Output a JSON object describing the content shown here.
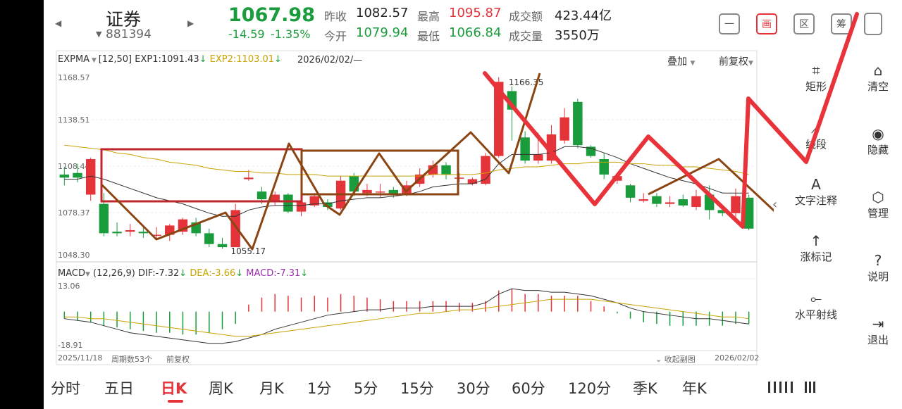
{
  "header": {
    "prev_arrow": "◀",
    "next_arrow": "▶",
    "name": "证券",
    "code": "881394",
    "price": "1067.98",
    "change": "-14.59",
    "change_pct": "-1.35%",
    "stats": [
      {
        "label": "昨收",
        "value": "1082.57",
        "color": "dark"
      },
      {
        "label": "最高",
        "value": "1095.87",
        "color": "red"
      },
      {
        "label": "成交额",
        "value": "423.44亿",
        "color": "dark"
      },
      {
        "label": "今开",
        "value": "1079.94",
        "color": "green"
      },
      {
        "label": "最低",
        "value": "1066.84",
        "color": "green"
      },
      {
        "label": "成交量",
        "value": "3550万",
        "color": "dark"
      }
    ],
    "tool_buttons": [
      {
        "name": "minimize-icon",
        "glyph": "一"
      },
      {
        "name": "draw-icon",
        "glyph": "画"
      },
      {
        "name": "range-icon",
        "glyph": "区"
      },
      {
        "name": "chip-icon",
        "glyph": "筹"
      }
    ]
  },
  "indicator_bar": {
    "name": "EXPMA",
    "params": "[12,50]",
    "exp1_label": "EXP1:1091.43",
    "exp2_label": "EXP2:1103.01",
    "date": "2026/02/02/—",
    "overlay": "叠加",
    "adjust": "前复权"
  },
  "macd_bar": {
    "name": "MACD",
    "params": "(12,26,9)",
    "dif": "DIF:-7.32",
    "dea": "DEA:-3.66",
    "macd": "MACD:-7.31"
  },
  "footer": {
    "start_date": "2025/11/18",
    "period_count": "周期数53个",
    "adjust": "前复权",
    "collapse": "收起副图",
    "end_date": "2026/02/02"
  },
  "draw_tools": [
    {
      "name": "rect-tool",
      "icon": "⌗",
      "label": "矩形"
    },
    {
      "name": "segment-tool",
      "icon": "⟋",
      "label": "线段"
    },
    {
      "name": "text-tool",
      "icon": "A",
      "label": "文字注释"
    },
    {
      "name": "rise-mark-tool",
      "icon": "↑",
      "label": "涨标记"
    },
    {
      "name": "ray-tool",
      "icon": "⟜",
      "label": "水平射线"
    }
  ],
  "side_tools": [
    {
      "name": "clear",
      "icon": "⌂",
      "label": "清空"
    },
    {
      "name": "hide",
      "icon": "◉",
      "label": "隐藏"
    },
    {
      "name": "manage",
      "icon": "⬡",
      "label": "管理"
    },
    {
      "name": "help",
      "icon": "?",
      "label": "说明"
    },
    {
      "name": "exit",
      "icon": "⇥",
      "label": "退出"
    }
  ],
  "tabs": [
    "分时",
    "五日",
    "日K",
    "周K",
    "月K",
    "1分",
    "5分",
    "15分",
    "30分",
    "60分",
    "120分",
    "季K",
    "年K"
  ],
  "active_tab": "日K",
  "chart_data": {
    "type": "candlestick",
    "ylim": [
      1048.3,
      1168.57
    ],
    "y_tick_labels": [
      "1168.57",
      "1138.51",
      "1108.44",
      "1078.37",
      "1048.30"
    ],
    "high_label": "1166.35",
    "low_label": "1055.17",
    "candles": [
      {
        "o": 1103,
        "c": 1101,
        "h": 1108,
        "l": 1096
      },
      {
        "o": 1104,
        "c": 1101,
        "h": 1110,
        "l": 1098
      },
      {
        "o": 1090,
        "c": 1113,
        "h": 1114,
        "l": 1086
      },
      {
        "o": 1084,
        "c": 1065,
        "h": 1091,
        "l": 1063
      },
      {
        "o": 1066,
        "c": 1065,
        "h": 1072,
        "l": 1063
      },
      {
        "o": 1066,
        "c": 1067,
        "h": 1071,
        "l": 1063
      },
      {
        "o": 1066,
        "c": 1065,
        "h": 1069,
        "l": 1062
      },
      {
        "o": 1064,
        "c": 1064,
        "h": 1069,
        "l": 1061
      },
      {
        "o": 1064,
        "c": 1070,
        "h": 1071,
        "l": 1060
      },
      {
        "o": 1066,
        "c": 1074,
        "h": 1075,
        "l": 1064
      },
      {
        "o": 1072,
        "c": 1065,
        "h": 1075,
        "l": 1063
      },
      {
        "o": 1065,
        "c": 1058,
        "h": 1068,
        "l": 1056
      },
      {
        "o": 1058,
        "c": 1056,
        "h": 1062,
        "l": 1055
      },
      {
        "o": 1056,
        "c": 1080,
        "h": 1084,
        "l": 1056
      },
      {
        "o": 1100,
        "c": 1101,
        "h": 1106,
        "l": 1099
      },
      {
        "o": 1092,
        "c": 1087,
        "h": 1095,
        "l": 1084
      },
      {
        "o": 1085,
        "c": 1090,
        "h": 1092,
        "l": 1083
      },
      {
        "o": 1090,
        "c": 1079,
        "h": 1091,
        "l": 1078
      },
      {
        "o": 1079,
        "c": 1085,
        "h": 1090,
        "l": 1076
      },
      {
        "o": 1083,
        "c": 1089,
        "h": 1091,
        "l": 1082
      },
      {
        "o": 1085,
        "c": 1082,
        "h": 1087,
        "l": 1080
      },
      {
        "o": 1081,
        "c": 1099,
        "h": 1102,
        "l": 1080
      },
      {
        "o": 1102,
        "c": 1092,
        "h": 1104,
        "l": 1089
      },
      {
        "o": 1091,
        "c": 1093,
        "h": 1097,
        "l": 1089
      },
      {
        "o": 1092,
        "c": 1092,
        "h": 1097,
        "l": 1088
      },
      {
        "o": 1093,
        "c": 1090,
        "h": 1095,
        "l": 1088
      },
      {
        "o": 1090,
        "c": 1096,
        "h": 1099,
        "l": 1089
      },
      {
        "o": 1097,
        "c": 1103,
        "h": 1107,
        "l": 1095
      },
      {
        "o": 1103,
        "c": 1109,
        "h": 1112,
        "l": 1101
      },
      {
        "o": 1109,
        "c": 1103,
        "h": 1111,
        "l": 1100
      },
      {
        "o": 1101,
        "c": 1101,
        "h": 1104,
        "l": 1098
      },
      {
        "o": 1097,
        "c": 1100,
        "h": 1101,
        "l": 1096
      },
      {
        "o": 1097,
        "c": 1115,
        "h": 1117,
        "l": 1096
      },
      {
        "o": 1115,
        "c": 1163,
        "h": 1166,
        "l": 1114
      },
      {
        "o": 1157,
        "c": 1145,
        "h": 1160,
        "l": 1125
      },
      {
        "o": 1127,
        "c": 1112,
        "h": 1131,
        "l": 1110
      },
      {
        "o": 1112,
        "c": 1116,
        "h": 1130,
        "l": 1110
      },
      {
        "o": 1112,
        "c": 1129,
        "h": 1135,
        "l": 1110
      },
      {
        "o": 1125,
        "c": 1140,
        "h": 1146,
        "l": 1123
      },
      {
        "o": 1150,
        "c": 1122,
        "h": 1152,
        "l": 1120
      },
      {
        "o": 1121,
        "c": 1115,
        "h": 1122,
        "l": 1114
      },
      {
        "o": 1113,
        "c": 1103,
        "h": 1117,
        "l": 1100
      },
      {
        "o": 1099,
        "c": 1102,
        "h": 1103,
        "l": 1097
      },
      {
        "o": 1096,
        "c": 1088,
        "h": 1097,
        "l": 1085
      },
      {
        "o": 1086,
        "c": 1087,
        "h": 1091,
        "l": 1085
      },
      {
        "o": 1089,
        "c": 1084,
        "h": 1091,
        "l": 1082
      },
      {
        "o": 1084,
        "c": 1085,
        "h": 1089,
        "l": 1082
      },
      {
        "o": 1087,
        "c": 1083,
        "h": 1090,
        "l": 1082
      },
      {
        "o": 1082,
        "c": 1089,
        "h": 1093,
        "l": 1080
      },
      {
        "o": 1090,
        "c": 1080,
        "h": 1096,
        "l": 1074
      },
      {
        "o": 1080,
        "c": 1078,
        "h": 1083,
        "l": 1076
      },
      {
        "o": 1078,
        "c": 1089,
        "h": 1094,
        "l": 1073
      },
      {
        "o": 1088,
        "c": 1068,
        "h": 1090,
        "l": 1067
      }
    ],
    "exp1": [
      1100,
      1100,
      1102,
      1100,
      1097,
      1094,
      1091,
      1088,
      1086,
      1084,
      1081,
      1078,
      1076,
      1076,
      1080,
      1082,
      1083,
      1083,
      1083,
      1084,
      1084,
      1086,
      1087,
      1088,
      1088,
      1089,
      1090,
      1092,
      1095,
      1096,
      1097,
      1097,
      1100,
      1110,
      1116,
      1116,
      1116,
      1117,
      1121,
      1121,
      1120,
      1117,
      1114,
      1110,
      1107,
      1104,
      1101,
      1099,
      1097,
      1094,
      1091,
      1091,
      1091
    ],
    "exp2": [
      1122,
      1121,
      1120,
      1119,
      1117,
      1116,
      1114,
      1113,
      1111,
      1110,
      1109,
      1107,
      1106,
      1105,
      1105,
      1104,
      1104,
      1103,
      1103,
      1103,
      1102,
      1102,
      1102,
      1102,
      1102,
      1102,
      1102,
      1102,
      1103,
      1103,
      1103,
      1103,
      1104,
      1106,
      1107,
      1108,
      1108,
      1109,
      1110,
      1110,
      1111,
      1111,
      1111,
      1110,
      1110,
      1109,
      1109,
      1108,
      1108,
      1107,
      1106,
      1105,
      1103
    ],
    "macd": {
      "ylim": [
        -18.91,
        13.06
      ],
      "hist": [
        -4,
        -5,
        -6,
        -8,
        -9,
        -10,
        -11,
        -12,
        -12,
        -13,
        -13,
        -12,
        -10,
        -7,
        4,
        8,
        10,
        9,
        8,
        9,
        8,
        10,
        9,
        8,
        7,
        6,
        6,
        6,
        6,
        6,
        5,
        5,
        6,
        12,
        13,
        10,
        10,
        9,
        9,
        9,
        6,
        3,
        -1,
        -4,
        -6,
        -7,
        -8,
        -8,
        -8,
        -8,
        -8,
        -7,
        -7
      ],
      "dif": [
        -4,
        -5,
        -6,
        -8,
        -10,
        -12,
        -13,
        -14,
        -15,
        -16,
        -17,
        -18,
        -18,
        -17,
        -15,
        -13,
        -10,
        -8,
        -6,
        -4,
        -2,
        -1,
        0,
        1,
        1,
        2,
        2,
        2,
        3,
        3,
        3,
        3,
        5,
        10,
        13,
        12,
        12,
        11,
        11,
        10,
        9,
        7,
        5,
        2,
        0,
        -1,
        -2,
        -3,
        -4,
        -4,
        -5,
        -6,
        -7
      ],
      "dea": [
        -3,
        -3,
        -4,
        -4,
        -5,
        -6,
        -7,
        -8,
        -9,
        -10,
        -11,
        -12,
        -13,
        -14,
        -14,
        -13,
        -12,
        -11,
        -10,
        -9,
        -8,
        -7,
        -6,
        -5,
        -4,
        -3,
        -2,
        -1,
        -1,
        0,
        1,
        1,
        2,
        3,
        4,
        5,
        6,
        7,
        7,
        7,
        7,
        6,
        5,
        4,
        3,
        2,
        1,
        0,
        -1,
        -2,
        -3,
        -3,
        -4
      ]
    }
  }
}
